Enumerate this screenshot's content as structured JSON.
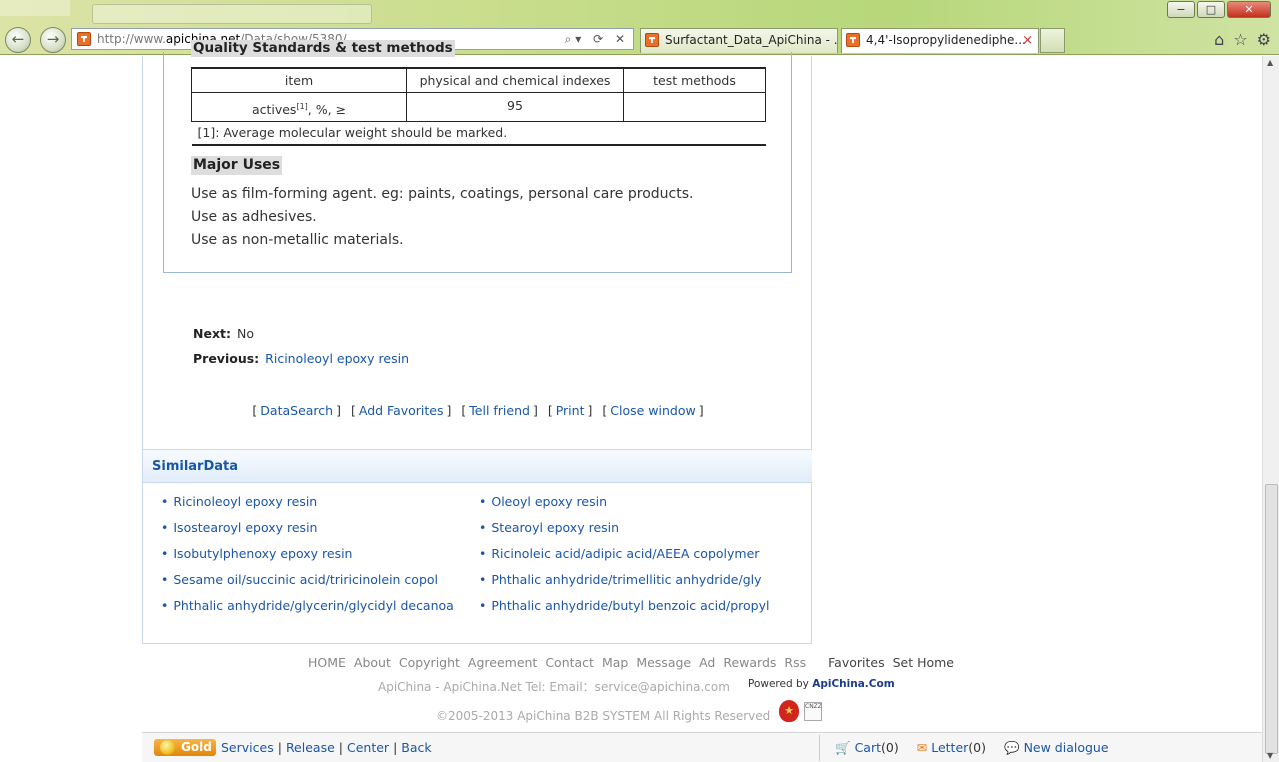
{
  "browser": {
    "url_prefix": "http://www.",
    "url_host": "apichina.net",
    "url_path": "/Data/show/5380/",
    "tabs": [
      {
        "label": "Surfactant_Data_ApiChina - ..."
      },
      {
        "label": "4,4'-Isopropylidenediphe..."
      }
    ],
    "tab_close": "×",
    "addr_tools": "⌕▾ ⟳ ✕",
    "back_glyph": "←",
    "forward_glyph": "→",
    "window_controls": {
      "minimize": "−",
      "maximize": "□",
      "close": "✕"
    },
    "right_icons": {
      "home": "⌂",
      "favorites": "☆",
      "tools": "⚙"
    }
  },
  "article": {
    "quality_heading": "Quality Standards & test methods",
    "table": {
      "headers": [
        "item",
        "physical and chemical indexes",
        "test methods"
      ],
      "row": {
        "item": "actives",
        "item_sup": "[1]",
        "item_suffix": ", %, ≥",
        "index": "95",
        "method": ""
      },
      "note": "[1]: Average molecular weight should be marked."
    },
    "uses_heading": "Major Uses",
    "uses": [
      "Use as film-forming agent. eg: paints, coatings, personal care products.",
      "Use as adhesives.",
      "Use as non-metallic materials."
    ]
  },
  "navigation": {
    "next_label": "Next:",
    "next_value": "No",
    "previous_label": "Previous:",
    "previous_value": "Ricinoleoyl epoxy resin"
  },
  "actions": [
    "DataSearch",
    "Add Favorites",
    "Tell friend",
    "Print",
    "Close window"
  ],
  "similar": {
    "title": "SimilarData",
    "left": [
      "Ricinoleoyl epoxy resin",
      "Isostearoyl epoxy resin",
      "Isobutylphenoxy epoxy resin",
      "Sesame oil/succinic acid/triricinolein copol",
      "Phthalic anhydride/glycerin/glycidyl decanoa"
    ],
    "right": [
      "Oleoyl epoxy resin",
      "Stearoyl epoxy resin",
      "Ricinoleic acid/adipic acid/AEEA copolymer",
      "Phthalic anhydride/trimellitic anhydride/gly",
      "Phthalic anhydride/butyl benzoic acid/propyl"
    ]
  },
  "footer": {
    "links": [
      "HOME",
      "About",
      "Copyright",
      "Agreement",
      "Contact",
      "Map",
      "Message",
      "Ad",
      "Rewards",
      "Rss"
    ],
    "extra_links": [
      "Favorites",
      "Set Home"
    ],
    "contact": "ApiChina - ApiChina.Net Tel:   Email：service@apichina.com",
    "powered_prefix": "Powered by ",
    "powered_brand": "ApiChina.Com",
    "copyright": "©2005-2013 ApiChina B2B SYSTEM All Rights Reserved",
    "badge_cnzz": "CNZZ"
  },
  "bottom_bar": {
    "gold": "Gold",
    "links": [
      "Services",
      "Release",
      "Center",
      "Back"
    ],
    "cart_label": "Cart",
    "cart_count": "(0)",
    "letter_label": "Letter",
    "letter_count": "(0)",
    "dialogue_label": "New dialogue"
  }
}
